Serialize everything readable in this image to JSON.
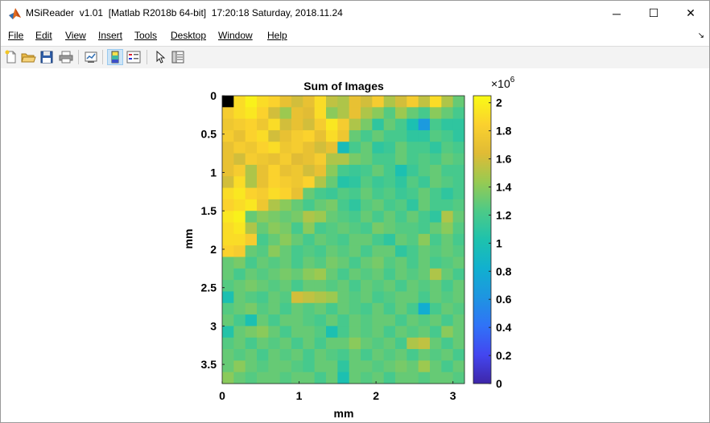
{
  "window": {
    "title": "MSiReader  v1.01  [Matlab R2018b 64-bit]  17:20:18 Saturday, 2018.11.24",
    "icon": "matlab-icon",
    "controls": {
      "minimize": "─",
      "maximize": "☐",
      "close": "✕"
    }
  },
  "menu": [
    {
      "label": "File",
      "name": "menu-file"
    },
    {
      "label": "Edit",
      "name": "menu-edit"
    },
    {
      "label": "View",
      "name": "menu-view"
    },
    {
      "label": "Insert",
      "name": "menu-insert"
    },
    {
      "label": "Tools",
      "name": "menu-tools"
    },
    {
      "label": "Desktop",
      "name": "menu-desktop"
    },
    {
      "label": "Window",
      "name": "menu-window"
    },
    {
      "label": "Help",
      "name": "menu-help"
    }
  ],
  "toolbar": [
    {
      "icon": "new-figure-icon"
    },
    {
      "icon": "open-file-icon"
    },
    {
      "icon": "save-icon"
    },
    {
      "icon": "print-icon"
    },
    {
      "icon": "link-plot-icon"
    },
    {
      "icon": "insert-colorbar-icon",
      "active": true
    },
    {
      "icon": "insert-legend-icon"
    },
    {
      "icon": "edit-plot-icon"
    },
    {
      "icon": "property-inspector-icon"
    }
  ],
  "chart_data": {
    "type": "heatmap",
    "title": "Sum of Images",
    "xlabel": "mm",
    "ylabel": "mm",
    "xlim": [
      0,
      3.15
    ],
    "ylim": [
      0,
      3.75
    ],
    "y_reversed": true,
    "x_ticks": [
      "0",
      "1",
      "2",
      "3"
    ],
    "y_ticks": [
      "0",
      "0.5",
      "1",
      "1.5",
      "2",
      "2.5",
      "3",
      "3.5"
    ],
    "colormap": "parula",
    "colorbar": {
      "range": [
        0,
        2050000
      ],
      "exponent_label": "×10",
      "exponent": "6",
      "ticks": [
        "0",
        "0.2",
        "0.4",
        "0.6",
        "0.8",
        "1",
        "1.2",
        "1.4",
        "1.6",
        "1.8",
        "2"
      ]
    },
    "rows": 25,
    "cols": 21,
    "values_millions": [
      [
        0.0,
        1.9,
        2.0,
        1.9,
        1.85,
        1.7,
        1.6,
        1.7,
        1.9,
        1.55,
        1.5,
        1.7,
        1.6,
        1.8,
        1.5,
        1.6,
        1.8,
        1.55,
        1.9,
        1.5,
        1.3
      ],
      [
        1.8,
        1.9,
        1.95,
        1.85,
        1.6,
        1.45,
        1.7,
        1.65,
        1.9,
        1.4,
        1.5,
        1.7,
        1.5,
        1.4,
        1.25,
        1.45,
        1.3,
        1.2,
        1.4,
        1.3,
        1.2
      ],
      [
        1.75,
        1.8,
        1.85,
        1.75,
        1.9,
        1.6,
        1.7,
        1.6,
        1.8,
        1.95,
        1.8,
        1.5,
        1.35,
        1.1,
        1.3,
        1.2,
        1.0,
        0.65,
        1.2,
        1.1,
        1.1
      ],
      [
        1.8,
        1.7,
        1.85,
        1.9,
        1.6,
        1.7,
        1.8,
        1.85,
        1.7,
        1.9,
        1.75,
        1.3,
        1.2,
        1.3,
        1.2,
        1.2,
        1.1,
        1.1,
        1.25,
        1.2,
        1.1
      ],
      [
        1.7,
        1.8,
        1.75,
        1.85,
        1.9,
        1.75,
        1.8,
        1.7,
        1.6,
        1.7,
        0.95,
        1.2,
        1.3,
        1.1,
        1.15,
        1.3,
        1.2,
        1.2,
        1.1,
        1.25,
        1.2
      ],
      [
        1.7,
        1.6,
        1.8,
        1.75,
        1.7,
        1.8,
        1.65,
        1.7,
        1.8,
        1.5,
        1.5,
        1.35,
        1.3,
        1.2,
        1.2,
        1.3,
        1.2,
        1.25,
        1.2,
        1.3,
        1.25
      ],
      [
        1.7,
        1.8,
        1.5,
        1.7,
        1.85,
        1.7,
        1.75,
        1.6,
        1.7,
        1.4,
        1.2,
        1.15,
        1.2,
        1.3,
        1.2,
        1.0,
        1.15,
        1.25,
        1.3,
        1.2,
        1.2
      ],
      [
        1.6,
        1.9,
        1.5,
        1.7,
        1.85,
        1.8,
        1.75,
        1.85,
        1.5,
        1.3,
        1.05,
        1.1,
        1.25,
        1.15,
        1.2,
        1.1,
        1.25,
        1.15,
        1.3,
        1.25,
        1.2
      ],
      [
        1.9,
        1.95,
        1.85,
        1.8,
        1.9,
        1.85,
        1.7,
        1.3,
        1.2,
        1.15,
        1.25,
        1.2,
        1.3,
        1.2,
        1.25,
        1.15,
        1.2,
        1.3,
        1.2,
        1.1,
        1.2
      ],
      [
        1.85,
        1.9,
        1.95,
        1.75,
        1.5,
        1.4,
        1.3,
        1.2,
        1.3,
        1.35,
        1.2,
        1.1,
        1.25,
        1.3,
        1.2,
        1.25,
        1.1,
        1.3,
        1.2,
        1.2,
        1.25
      ],
      [
        1.95,
        2.0,
        1.3,
        1.4,
        1.35,
        1.3,
        1.35,
        1.5,
        1.45,
        1.3,
        1.25,
        1.2,
        1.3,
        1.2,
        1.3,
        1.2,
        1.3,
        1.2,
        1.1,
        1.5,
        1.3
      ],
      [
        1.9,
        1.95,
        1.5,
        1.3,
        1.4,
        1.35,
        1.2,
        1.4,
        1.2,
        1.25,
        1.3,
        1.25,
        1.2,
        1.35,
        1.3,
        1.25,
        1.25,
        1.2,
        1.3,
        1.4,
        1.25
      ],
      [
        1.9,
        1.9,
        1.8,
        1.2,
        1.3,
        1.4,
        1.3,
        1.2,
        1.3,
        1.25,
        1.2,
        1.3,
        1.3,
        1.2,
        1.1,
        1.3,
        1.25,
        1.4,
        1.2,
        1.3,
        1.2
      ],
      [
        1.85,
        1.8,
        1.3,
        1.25,
        1.4,
        1.3,
        1.2,
        1.25,
        1.2,
        1.3,
        1.25,
        1.3,
        1.2,
        1.3,
        1.3,
        1.1,
        1.2,
        1.3,
        1.25,
        1.3,
        1.25
      ],
      [
        1.3,
        1.35,
        1.2,
        1.3,
        1.25,
        1.3,
        1.2,
        1.3,
        1.25,
        1.35,
        1.3,
        1.2,
        1.3,
        1.35,
        1.25,
        1.3,
        1.2,
        1.3,
        1.2,
        1.25,
        1.3
      ],
      [
        1.3,
        1.2,
        1.3,
        1.25,
        1.3,
        1.35,
        1.3,
        1.4,
        1.45,
        1.3,
        1.2,
        1.3,
        1.25,
        1.3,
        1.2,
        1.3,
        1.25,
        1.3,
        1.5,
        1.3,
        1.2
      ],
      [
        1.25,
        1.3,
        1.35,
        1.3,
        1.25,
        1.3,
        1.2,
        1.3,
        1.3,
        1.25,
        1.3,
        1.2,
        1.3,
        1.25,
        1.3,
        1.2,
        1.3,
        1.25,
        1.3,
        1.2,
        1.3
      ],
      [
        1.0,
        1.3,
        1.25,
        1.2,
        1.3,
        1.25,
        1.6,
        1.55,
        1.5,
        1.45,
        1.3,
        1.25,
        1.3,
        1.2,
        1.25,
        1.3,
        1.3,
        1.2,
        1.3,
        1.25,
        1.3
      ],
      [
        1.25,
        1.3,
        1.35,
        1.25,
        1.3,
        1.2,
        1.3,
        1.25,
        1.3,
        1.2,
        1.3,
        1.25,
        1.2,
        1.3,
        1.2,
        1.3,
        1.2,
        0.8,
        1.2,
        1.3,
        1.25
      ],
      [
        1.3,
        1.2,
        1.0,
        1.3,
        1.2,
        1.3,
        1.3,
        1.25,
        1.2,
        1.3,
        1.2,
        1.3,
        1.25,
        1.3,
        1.3,
        1.2,
        1.3,
        1.25,
        1.3,
        1.2,
        1.3
      ],
      [
        1.05,
        1.3,
        1.35,
        1.4,
        1.3,
        1.2,
        1.3,
        1.3,
        1.25,
        1.0,
        1.2,
        1.3,
        1.25,
        1.3,
        1.2,
        1.3,
        1.25,
        1.3,
        1.2,
        1.4,
        1.3
      ],
      [
        1.25,
        1.3,
        1.2,
        1.3,
        1.25,
        1.3,
        1.2,
        1.3,
        1.2,
        1.3,
        1.3,
        1.4,
        1.3,
        1.25,
        1.3,
        1.2,
        1.5,
        1.55,
        1.3,
        1.2,
        1.3
      ],
      [
        1.3,
        1.25,
        1.3,
        1.2,
        1.3,
        1.25,
        1.3,
        1.2,
        1.3,
        1.25,
        1.2,
        1.3,
        1.2,
        1.3,
        1.25,
        1.3,
        1.2,
        1.3,
        1.25,
        1.3,
        1.2
      ],
      [
        1.3,
        1.4,
        1.3,
        1.25,
        1.3,
        1.3,
        1.25,
        1.2,
        1.3,
        1.3,
        1.1,
        1.3,
        1.3,
        1.25,
        1.3,
        1.35,
        1.3,
        1.45,
        1.3,
        1.2,
        1.3
      ],
      [
        1.4,
        1.3,
        1.25,
        1.3,
        1.3,
        1.25,
        1.3,
        1.3,
        1.2,
        1.3,
        1.0,
        1.3,
        1.25,
        1.3,
        1.2,
        1.3,
        1.3,
        1.25,
        1.3,
        1.3,
        1.25
      ]
    ]
  }
}
